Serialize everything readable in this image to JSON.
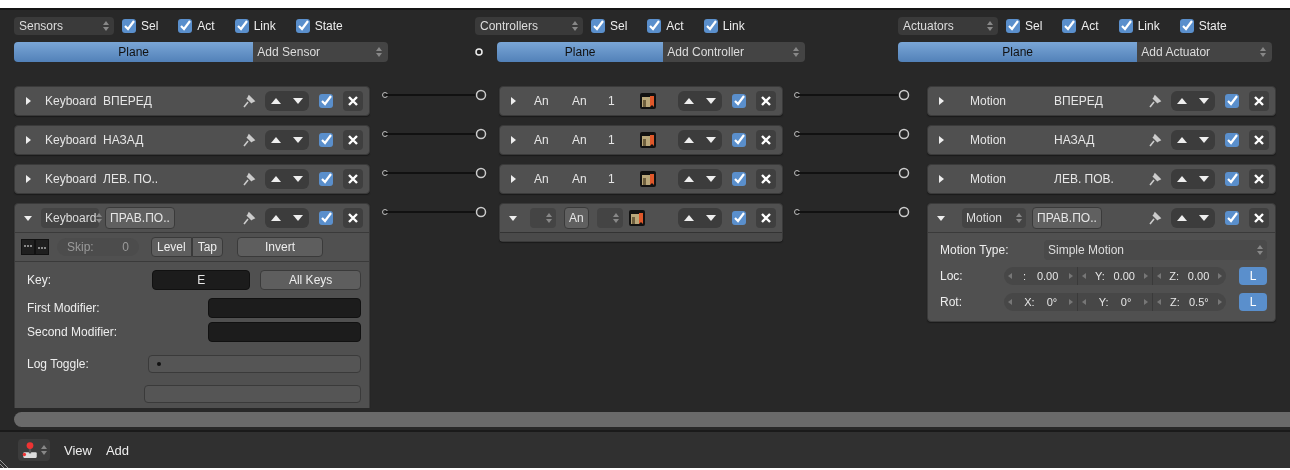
{
  "sensors": {
    "menu": "Sensors",
    "filters": [
      {
        "label": "Sel",
        "checked": true
      },
      {
        "label": "Act",
        "checked": true
      },
      {
        "label": "Link",
        "checked": true
      },
      {
        "label": "State",
        "checked": true
      }
    ],
    "object": "Plane",
    "add": "Add Sensor",
    "bricks": [
      {
        "type": "Keyboard",
        "name": "ВПЕРЕД",
        "expanded": false,
        "active": true
      },
      {
        "type": "Keyboard",
        "name": "НАЗАД",
        "expanded": false,
        "active": true
      },
      {
        "type": "Keyboard",
        "name": "ЛЕВ. ПО..",
        "expanded": false,
        "active": true
      },
      {
        "type": "Keyboard",
        "name": "ПРАВ.ПО..",
        "expanded": true,
        "active": true
      }
    ],
    "detail": {
      "skip_label": "Skip:",
      "skip_value": "0",
      "skip_disabled": true,
      "level": "Level",
      "tap": "Tap",
      "invert": "Invert",
      "key_label": "Key:",
      "key": "E",
      "all_keys": "All Keys",
      "first_modifier": "First Modifier:",
      "second_modifier": "Second Modifier:",
      "log_toggle": "Log Toggle:"
    }
  },
  "controllers": {
    "menu": "Controllers",
    "filters": [
      {
        "label": "Sel",
        "checked": true
      },
      {
        "label": "Act",
        "checked": true
      },
      {
        "label": "Link",
        "checked": true
      }
    ],
    "object": "Plane",
    "add": "Add Controller",
    "bricks": [
      {
        "type": "An",
        "name": "An",
        "priority": "1",
        "expanded": false,
        "active": true
      },
      {
        "type": "An",
        "name": "An",
        "priority": "1",
        "expanded": false,
        "active": true
      },
      {
        "type": "An",
        "name": "An",
        "priority": "1",
        "expanded": false,
        "active": true
      },
      {
        "name": "An",
        "expanded": true,
        "active": true
      }
    ]
  },
  "actuators": {
    "menu": "Actuators",
    "filters": [
      {
        "label": "Sel",
        "checked": true
      },
      {
        "label": "Act",
        "checked": true
      },
      {
        "label": "Link",
        "checked": true
      },
      {
        "label": "State",
        "checked": true
      }
    ],
    "object": "Plane",
    "add": "Add Actuator",
    "bricks": [
      {
        "type": "Motion",
        "name": "ВПЕРЕД",
        "expanded": false,
        "active": true
      },
      {
        "type": "Motion",
        "name": "НАЗАД",
        "expanded": false,
        "active": true
      },
      {
        "type": "Motion",
        "name": "ЛЕВ. ПОВ.",
        "expanded": false,
        "active": true
      },
      {
        "type": "Motion",
        "name": "ПРАВ.ПО..",
        "expanded": true,
        "active": true
      }
    ],
    "detail": {
      "motion_type_label": "Motion Type:",
      "motion_type": "Simple Motion",
      "rows": [
        {
          "label": "Loc:",
          "fields": [
            {
              "axis": ":",
              "value": "0.00"
            },
            {
              "axis": "Y:",
              "value": "0.00"
            },
            {
              "axis": "Z:",
              "value": "0.00"
            }
          ],
          "local": {
            "label": "L",
            "on": true
          }
        },
        {
          "label": "Rot:",
          "fields": [
            {
              "axis": "X:",
              "value": "0°"
            },
            {
              "axis": "Y:",
              "value": "0°"
            },
            {
              "axis": "Z:",
              "value": "0.5°"
            }
          ],
          "local": {
            "label": "L",
            "on": true
          }
        }
      ]
    }
  },
  "header": {
    "menus": [
      "View",
      "Add"
    ]
  }
}
